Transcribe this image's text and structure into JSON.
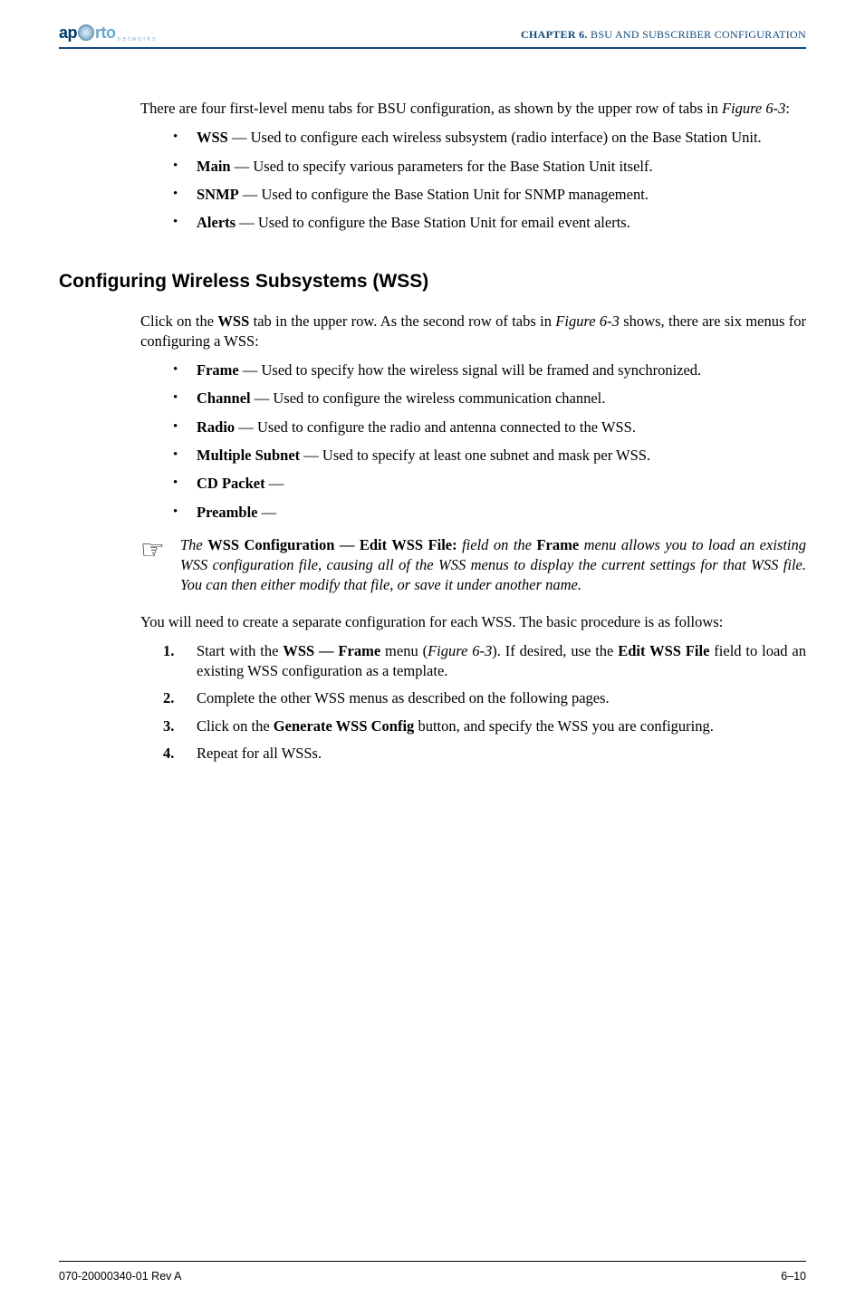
{
  "header": {
    "logo_text_a": "ap",
    "logo_text_b": "rto",
    "logo_sub": "networks",
    "chapter_prefix": "CHAPTER 6.  ",
    "chapter_title": "BSU AND SUBSCRIBER CONFIGURATION"
  },
  "intro": {
    "p1_a": "There are four first-level menu tabs for BSU configuration, as shown by the upper row of tabs in ",
    "p1_fig": "Figure 6-3",
    "p1_b": ":",
    "bullets": [
      {
        "term": "WSS",
        "desc": " — Used to configure each wireless subsystem (radio interface) on the Base Station Unit."
      },
      {
        "term": "Main",
        "desc": " — Used to specify various parameters for the Base Station Unit itself."
      },
      {
        "term": "SNMP",
        "desc": " — Used to configure the Base Station Unit for SNMP management."
      },
      {
        "term": "Alerts",
        "desc": " — Used to configure the Base Station Unit for email event alerts."
      }
    ]
  },
  "section": {
    "title": "Configuring Wireless Subsystems (WSS)",
    "p1_a": "Click on the ",
    "p1_b": "WSS",
    "p1_c": " tab in the upper row. As the second row of tabs in ",
    "p1_fig": "Figure 6-3",
    "p1_d": " shows, there are six menus for configuring a WSS:",
    "bullets": [
      {
        "term": "Frame",
        "desc": " — Used to specify how the wireless signal will be framed and synchronized."
      },
      {
        "term": "Channel",
        "desc": " — Used to configure the wireless communication channel."
      },
      {
        "term": "Radio",
        "desc": " — Used to configure the radio and antenna connected to the WSS."
      },
      {
        "term": "Multiple Subnet",
        "desc": " — Used to specify at least one subnet and mask per WSS."
      },
      {
        "term": "CD Packet",
        "desc": " — "
      },
      {
        "term": "Preamble",
        "desc": " — "
      }
    ],
    "note_a": "The ",
    "note_b": "WSS Configuration — Edit WSS File:",
    "note_c": " field on the ",
    "note_d": "Frame",
    "note_e": " menu allows you to load an existing WSS configuration file, causing all of the WSS menus to display the current settings for that WSS file. You can then either modify that file, or save it under another name.",
    "p2": "You will need to create a separate configuration for each WSS. The basic procedure is as follows:",
    "steps": [
      {
        "n": "1.",
        "a": "Start with the ",
        "b": "WSS — Frame",
        "c": " menu (",
        "fig": "Figure 6-3",
        "d": "). If desired, use the ",
        "e": "Edit WSS File",
        "f": " field to load an existing WSS configuration as a template."
      },
      {
        "n": "2.",
        "a": "Complete the other WSS menus as described on the following pages.",
        "b": "",
        "c": "",
        "fig": "",
        "d": "",
        "e": "",
        "f": ""
      },
      {
        "n": "3.",
        "a": "Click on the ",
        "b": "Generate WSS Config",
        "c": " button, and specify the WSS you are configuring.",
        "fig": "",
        "d": "",
        "e": "",
        "f": ""
      },
      {
        "n": "4.",
        "a": "Repeat for all WSSs.",
        "b": "",
        "c": "",
        "fig": "",
        "d": "",
        "e": "",
        "f": ""
      }
    ]
  },
  "footer": {
    "left": "070-20000340-01 Rev A",
    "right": "6–10"
  }
}
